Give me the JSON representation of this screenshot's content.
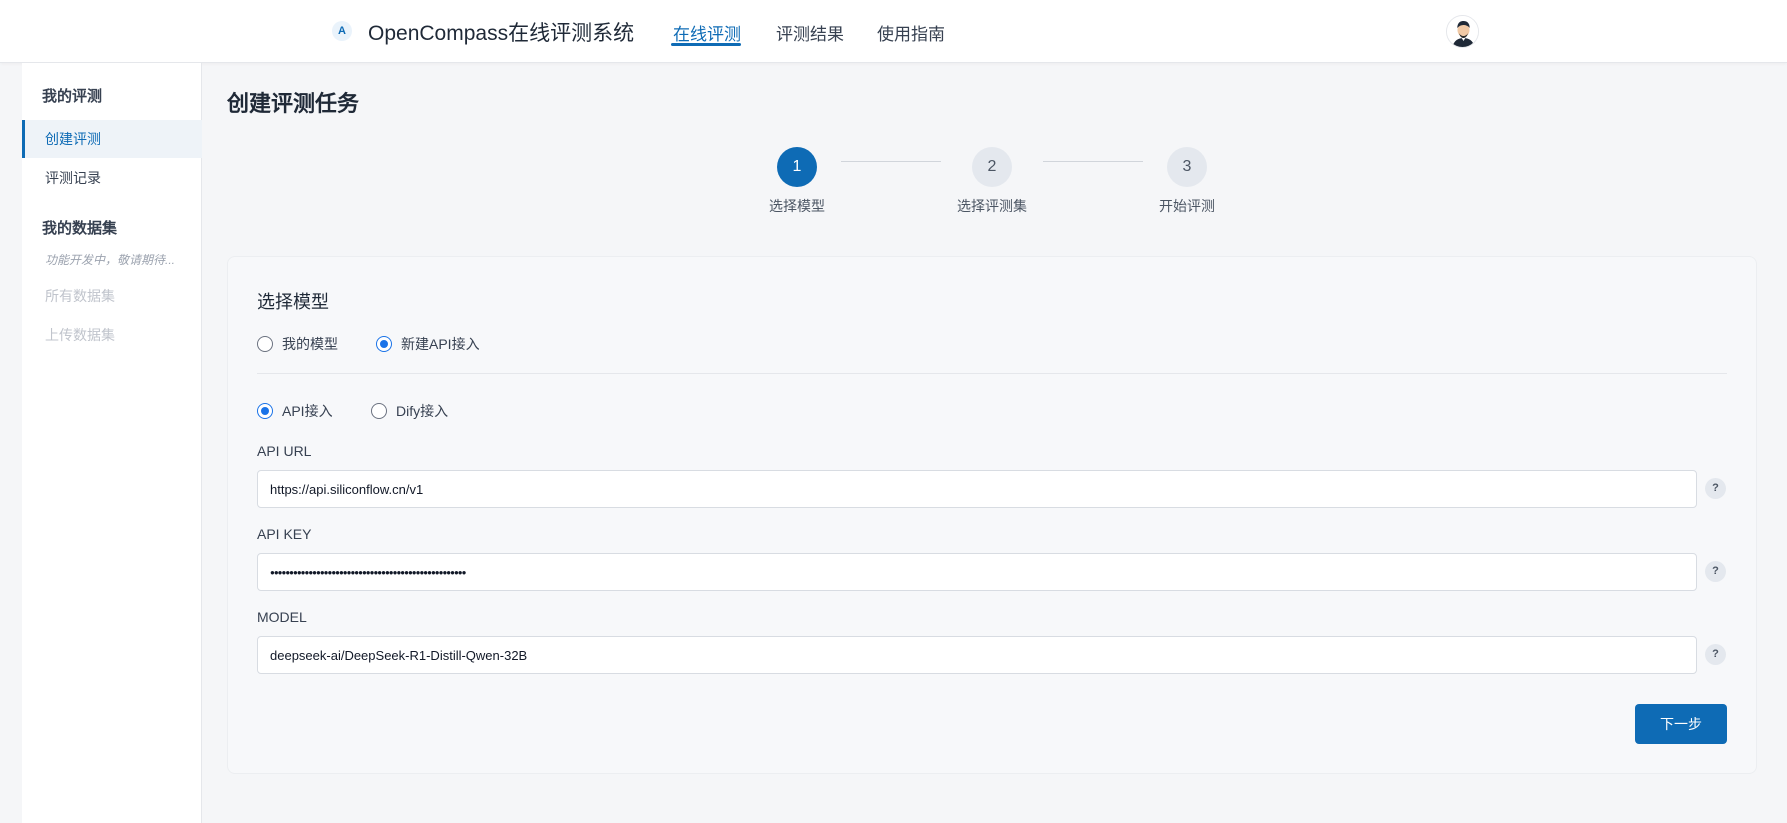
{
  "header": {
    "logo_glyph": "A",
    "app_title": "OpenCompass在线评测系统",
    "nav": [
      {
        "label": "在线评测",
        "active": true
      },
      {
        "label": "评测结果",
        "active": false
      },
      {
        "label": "使用指南",
        "active": false
      }
    ],
    "avatar_icon": "user-avatar-icon"
  },
  "sidebar": {
    "section1_title": "我的评测",
    "section1_items": [
      {
        "label": "创建评测",
        "active": true
      },
      {
        "label": "评测记录",
        "active": false
      }
    ],
    "section2_title": "我的数据集",
    "section2_note": "功能开发中，敬请期待...",
    "section2_items": [
      {
        "label": "所有数据集",
        "disabled": true
      },
      {
        "label": "上传数据集",
        "disabled": true
      }
    ]
  },
  "main": {
    "page_title": "创建评测任务",
    "steps": [
      {
        "number": "1",
        "label": "选择模型",
        "active": true
      },
      {
        "number": "2",
        "label": "选择评测集",
        "active": false
      },
      {
        "number": "3",
        "label": "开始评测",
        "active": false
      }
    ],
    "panel_title": "选择模型",
    "model_source": {
      "options": [
        {
          "label": "我的模型",
          "checked": false
        },
        {
          "label": "新建API接入",
          "checked": true
        }
      ]
    },
    "access_type": {
      "options": [
        {
          "label": "API接入",
          "checked": true
        },
        {
          "label": "Dify接入",
          "checked": false
        }
      ]
    },
    "fields": {
      "api_url": {
        "label": "API URL",
        "value": "https://api.siliconflow.cn/v1",
        "help": "?"
      },
      "api_key": {
        "label": "API KEY",
        "value": "●●●●●●●●●●●●●●●●●●●●●●●●●●●●●●●●●●●●●●●●●●●●●●●●●●●",
        "help": "?"
      },
      "model": {
        "label": "MODEL",
        "value": "deepseek-ai/DeepSeek-R1-Distill-Qwen-32B",
        "help": "?"
      }
    },
    "next_button": "下一步"
  },
  "colors": {
    "accent": "#0e6bb5",
    "radio_checked": "#1a73e8"
  }
}
